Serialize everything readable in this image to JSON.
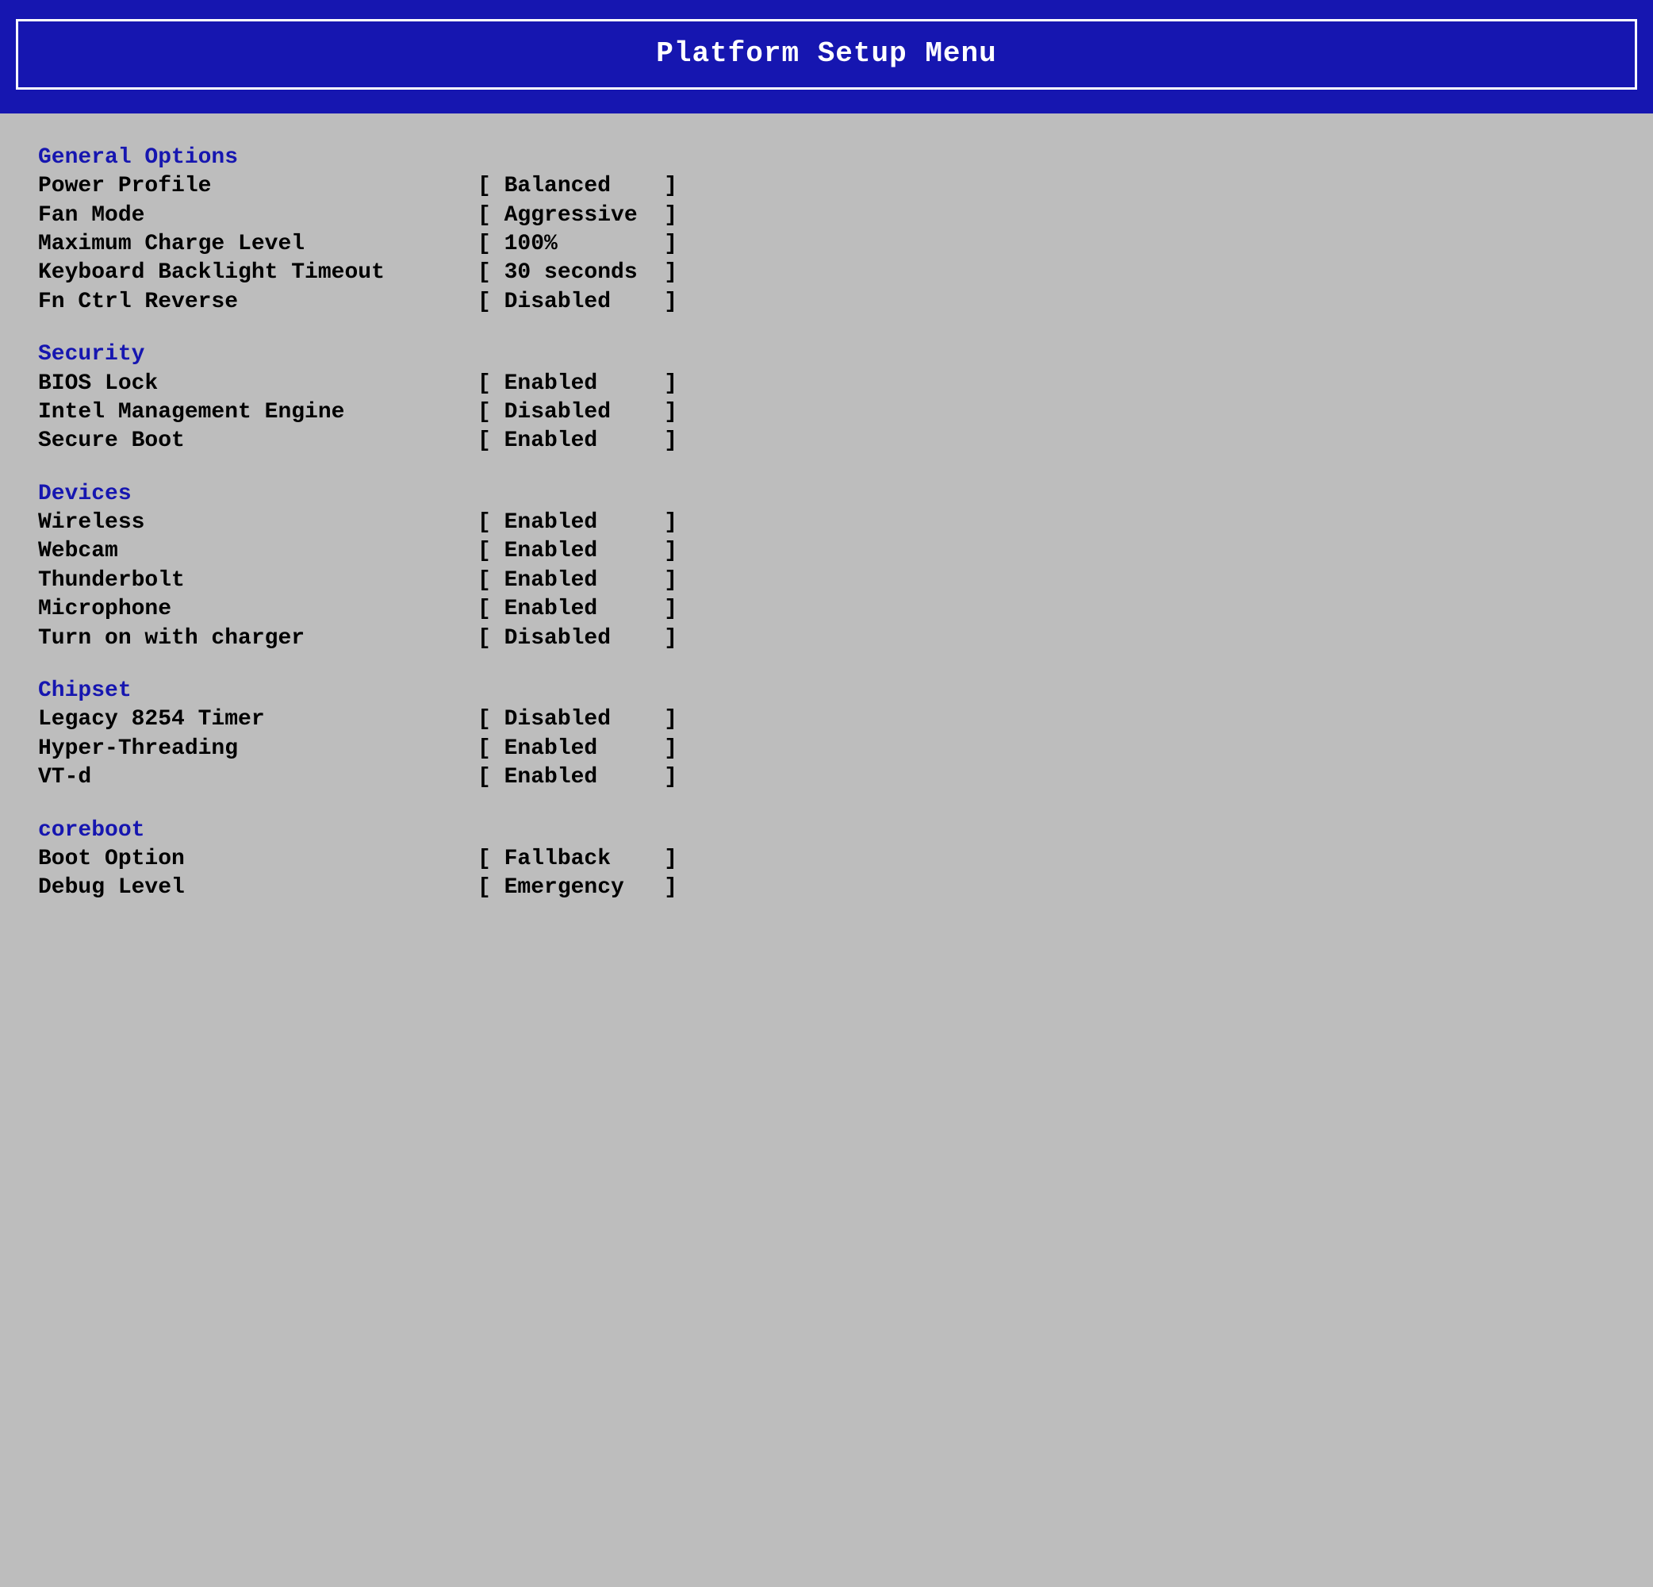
{
  "title": "Platform Setup Menu",
  "sections": [
    {
      "header": "General Options",
      "items": [
        {
          "label": "Power Profile",
          "value": "Balanced"
        },
        {
          "label": "Fan Mode",
          "value": "Aggressive"
        },
        {
          "label": "Maximum Charge Level",
          "value": "100%"
        },
        {
          "label": "Keyboard Backlight Timeout",
          "value": "30 seconds"
        },
        {
          "label": "Fn Ctrl Reverse",
          "value": "Disabled"
        }
      ]
    },
    {
      "header": "Security",
      "items": [
        {
          "label": "BIOS Lock",
          "value": "Enabled"
        },
        {
          "label": "Intel Management Engine",
          "value": "Disabled"
        },
        {
          "label": "Secure Boot",
          "value": "Enabled"
        }
      ]
    },
    {
      "header": "Devices",
      "items": [
        {
          "label": "Wireless",
          "value": "Enabled"
        },
        {
          "label": "Webcam",
          "value": "Enabled"
        },
        {
          "label": "Thunderbolt",
          "value": "Enabled"
        },
        {
          "label": "Microphone",
          "value": "Enabled"
        },
        {
          "label": "Turn on with charger",
          "value": "Disabled"
        }
      ]
    },
    {
      "header": "Chipset",
      "items": [
        {
          "label": "Legacy 8254 Timer",
          "value": "Disabled"
        },
        {
          "label": "Hyper-Threading",
          "value": "Enabled"
        },
        {
          "label": "VT-d",
          "value": "Enabled"
        }
      ]
    },
    {
      "header": "coreboot",
      "items": [
        {
          "label": "Boot Option",
          "value": "Fallback"
        },
        {
          "label": "Debug Level",
          "value": "Emergency"
        }
      ]
    }
  ]
}
